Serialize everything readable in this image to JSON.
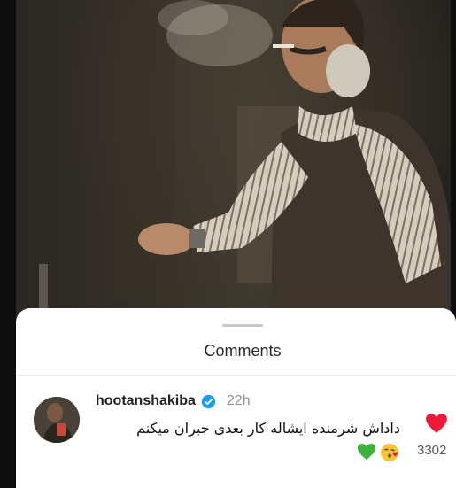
{
  "sheet": {
    "title": "Comments"
  },
  "comment": {
    "username": "hootanshakiba",
    "time": "22h",
    "text": "داداش شرمنده ایشاله کار بعدی جبران میکنم",
    "likes": "3302",
    "reactions": [
      "green-heart-emoji",
      "kissing-face-emoji"
    ]
  },
  "colors": {
    "sheet_bg": "#ffffff",
    "verified_blue": "#1d9bf0",
    "like_red": "#ed1b3a",
    "muted": "#8e8e8e"
  },
  "icons": {
    "verified": "verified-badge-icon",
    "like": "heart-icon"
  }
}
